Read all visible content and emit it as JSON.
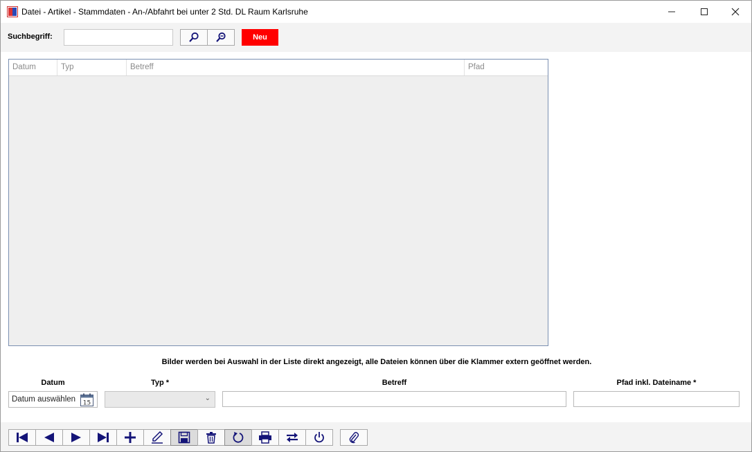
{
  "window": {
    "title": "Datei - Artikel - Stammdaten - An-/Abfahrt bei unter 2 Std. DL Raum Karlsruhe",
    "app_icon": "rw-app-icon",
    "controls": [
      "minimize-icon",
      "maximize-icon",
      "close-icon"
    ]
  },
  "search": {
    "label": "Suchbegriff:",
    "value": "",
    "search_icon": "search-icon",
    "clear_icon": "search-clear-icon",
    "new_label": "Neu",
    "new_color": "#ff0000"
  },
  "grid": {
    "columns": [
      "Datum",
      "Typ",
      "Betreff",
      "Pfad"
    ],
    "rows": []
  },
  "info_text": "Bilder werden bei Auswahl in der Liste direkt angezeigt, alle Dateien können über die Klammer extern geöffnet werden.",
  "form": {
    "datum_label": "Datum",
    "datum_placeholder": "Datum auswählen",
    "calendar_day": "15",
    "typ_label": "Typ *",
    "typ_value": "",
    "betreff_label": "Betreff",
    "betreff_value": "",
    "pfad_label": "Pfad inkl. Dateiname *",
    "pfad_value": ""
  },
  "toolbar": {
    "buttons": [
      "first-record-icon",
      "previous-record-icon",
      "next-record-icon",
      "last-record-icon",
      "add-icon",
      "edit-icon",
      "save-icon",
      "delete-icon",
      "undo-icon",
      "print-icon",
      "swap-icon",
      "power-icon",
      "paperclip-icon"
    ],
    "accent_color": "#1a1a8c"
  }
}
